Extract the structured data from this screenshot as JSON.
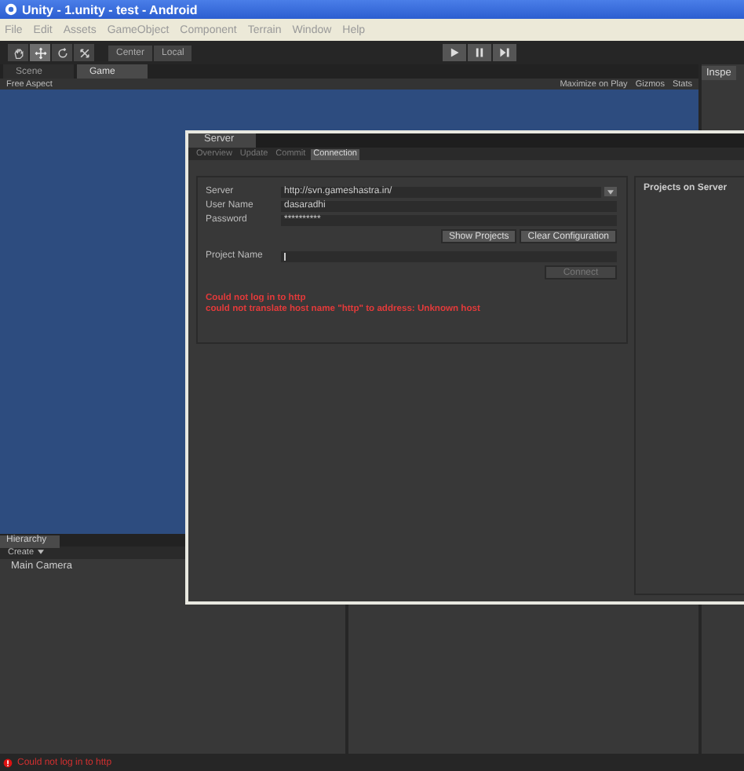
{
  "window": {
    "title": "Unity - 1.unity - test - Android"
  },
  "menu": [
    "File",
    "Edit",
    "Assets",
    "GameObject",
    "Component",
    "Terrain",
    "Window",
    "Help"
  ],
  "toolbar": {
    "tools": [
      {
        "kind": "hand",
        "selected": false
      },
      {
        "kind": "move",
        "selected": true
      },
      {
        "kind": "rotate",
        "selected": false
      },
      {
        "kind": "scale",
        "selected": false
      }
    ],
    "pivot": [
      "Center",
      "Local"
    ],
    "playback": [
      {
        "kind": "play"
      },
      {
        "kind": "pause"
      },
      {
        "kind": "step"
      }
    ]
  },
  "scene_tabs": [
    {
      "label": "Scene",
      "selected": false
    },
    {
      "label": "Game",
      "selected": true
    }
  ],
  "game_bar": {
    "aspect": "Free Aspect",
    "options": [
      "Maximize on Play",
      "Gizmos",
      "Stats"
    ]
  },
  "inspector_tab": {
    "label": "Inspe"
  },
  "server_window": {
    "title": "Server",
    "tabs": [
      {
        "label": "Overview",
        "selected": false
      },
      {
        "label": "Update",
        "selected": false
      },
      {
        "label": "Commit",
        "selected": false
      },
      {
        "label": "Connection",
        "selected": true
      }
    ],
    "fields": [
      {
        "label": "Server",
        "value": "http://svn.gameshastra.in/",
        "dropdown": true
      },
      {
        "label": "User Name",
        "value": "dasaradhi",
        "dropdown": false
      },
      {
        "label": "Password",
        "value": "**********",
        "dropdown": false
      }
    ],
    "buttons": [
      "Show Projects",
      "Clear Configuration"
    ],
    "project_field": {
      "label": "Project Name"
    },
    "connect_button": {
      "label": "Connect",
      "disabled": true
    },
    "errors": [
      "Could not log in to http",
      "could not translate host name \"http\" to address: Unknown host"
    ],
    "projects_title": "Projects on Server"
  },
  "hierarchy": {
    "title": "Hierarchy",
    "create": "Create",
    "items": [
      "Main Camera"
    ]
  },
  "status_bar": {
    "message": "Could not log in to http"
  }
}
